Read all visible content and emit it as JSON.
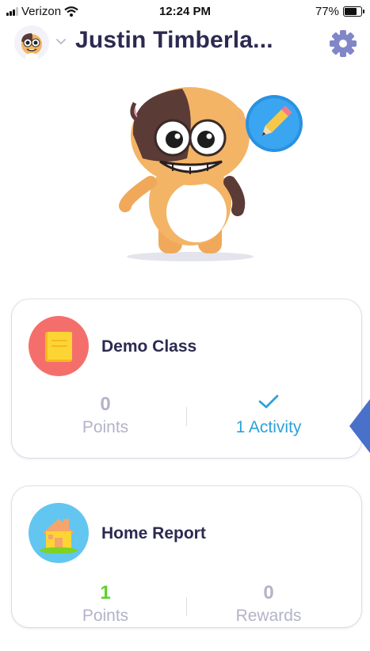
{
  "status_bar": {
    "carrier": "Verizon",
    "time": "12:24 PM",
    "battery": "77%"
  },
  "header": {
    "title": "Justin Timberla..."
  },
  "cards": [
    {
      "title": "Demo Class",
      "stat_left": {
        "value": "0",
        "label": "Points"
      },
      "stat_right": {
        "label": "1 Activity"
      }
    },
    {
      "title": "Home Report",
      "stat_left": {
        "value": "1",
        "label": "Points"
      },
      "stat_right": {
        "value": "0",
        "label": "Rewards"
      }
    }
  ],
  "colors": {
    "accent_blue": "#2ba2dc",
    "muted_text": "#b3b3c9",
    "points_green": "#5cd12d",
    "title_navy": "#2c2a50",
    "class_icon_bg": "#f46f6c",
    "home_icon_bg": "#62c6f1",
    "gear": "#8186c9",
    "pointer_blue": "#4971c9"
  },
  "icons": [
    "signal-icon",
    "wifi-icon",
    "battery-icon",
    "chevron-down-icon",
    "gear-icon",
    "pencil-icon",
    "notebook-icon",
    "house-icon",
    "checkmark-icon",
    "pointer-arrow-icon"
  ]
}
